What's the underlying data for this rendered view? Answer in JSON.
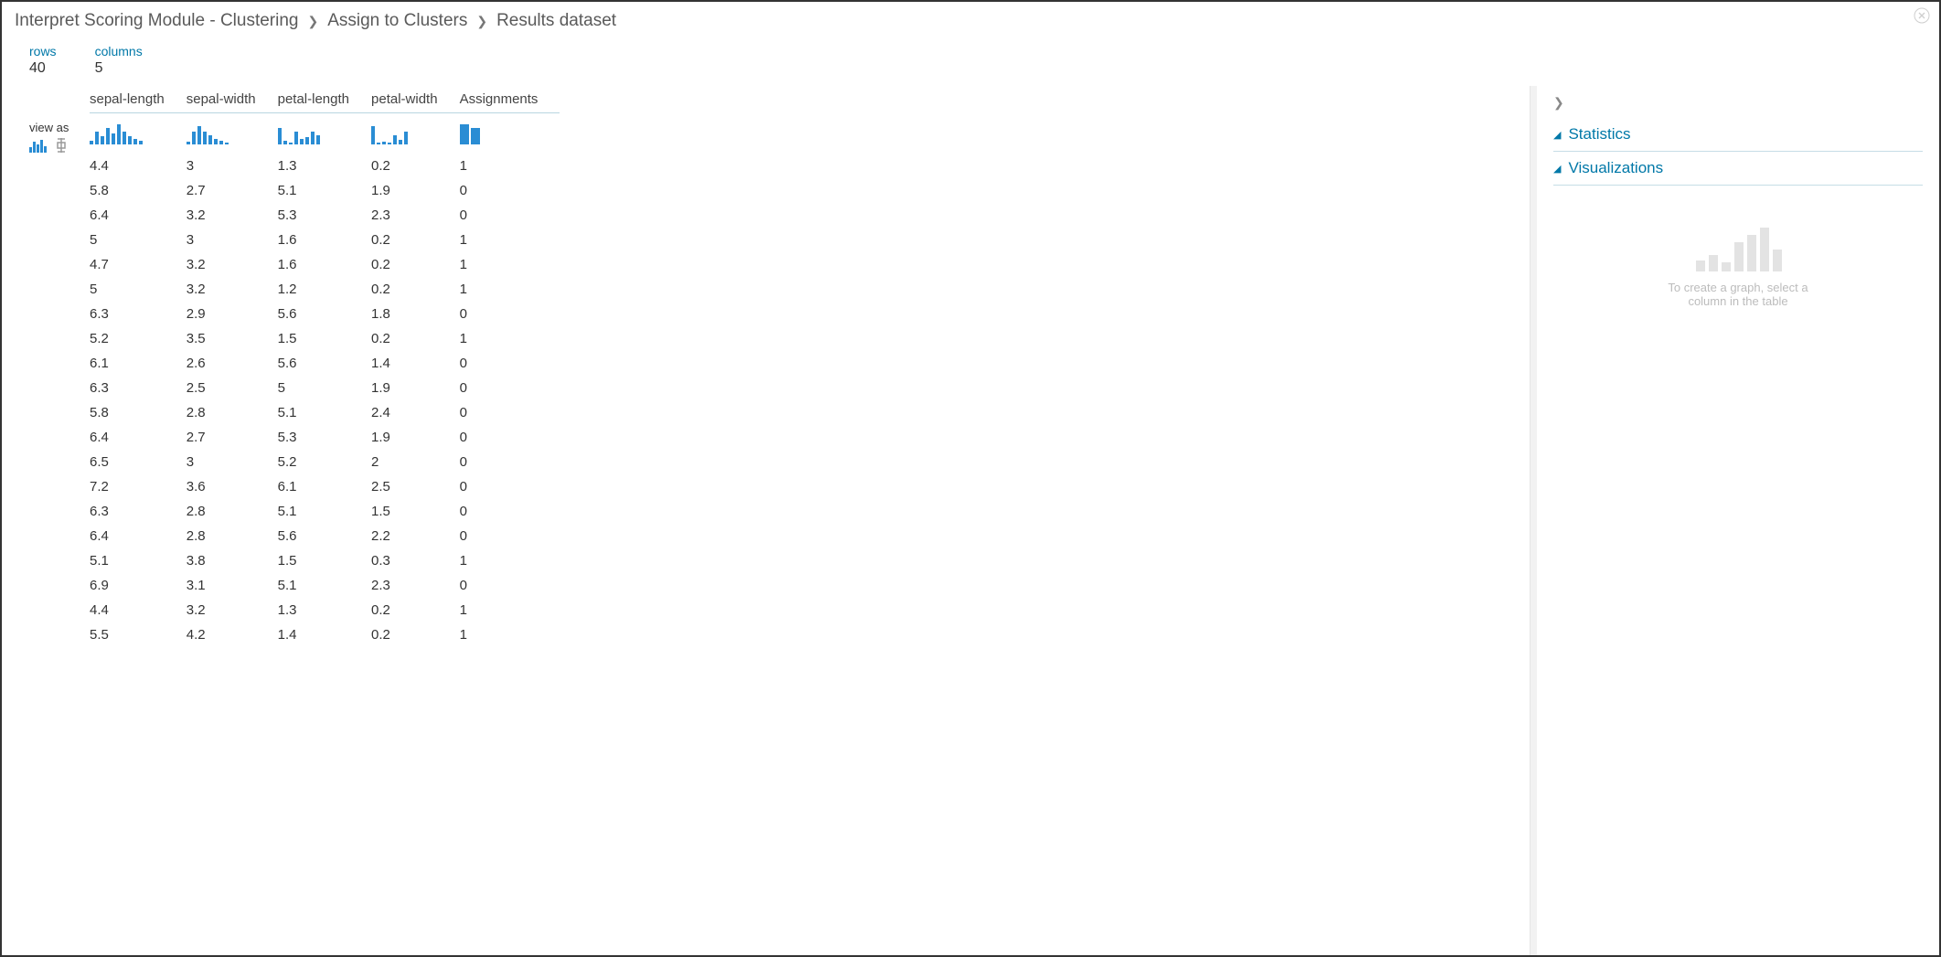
{
  "breadcrumb": [
    "Interpret Scoring Module - Clustering",
    "Assign to Clusters",
    "Results dataset"
  ],
  "meta": {
    "rows_label": "rows",
    "rows_value": "40",
    "cols_label": "columns",
    "cols_value": "5"
  },
  "viewas_label": "view as",
  "columns": [
    "sepal-length",
    "sepal-width",
    "petal-length",
    "petal-width",
    "Assignments"
  ],
  "sparklines": [
    [
      4,
      14,
      9,
      18,
      12,
      22,
      14,
      9,
      6,
      4
    ],
    [
      3,
      14,
      20,
      14,
      10,
      6,
      4,
      2
    ],
    [
      18,
      4,
      2,
      14,
      6,
      8,
      14,
      10
    ],
    [
      20,
      2,
      3,
      2,
      10,
      5,
      14
    ],
    [
      22,
      18
    ]
  ],
  "rows": [
    [
      "4.4",
      "3",
      "1.3",
      "0.2",
      "1"
    ],
    [
      "5.8",
      "2.7",
      "5.1",
      "1.9",
      "0"
    ],
    [
      "6.4",
      "3.2",
      "5.3",
      "2.3",
      "0"
    ],
    [
      "5",
      "3",
      "1.6",
      "0.2",
      "1"
    ],
    [
      "4.7",
      "3.2",
      "1.6",
      "0.2",
      "1"
    ],
    [
      "5",
      "3.2",
      "1.2",
      "0.2",
      "1"
    ],
    [
      "6.3",
      "2.9",
      "5.6",
      "1.8",
      "0"
    ],
    [
      "5.2",
      "3.5",
      "1.5",
      "0.2",
      "1"
    ],
    [
      "6.1",
      "2.6",
      "5.6",
      "1.4",
      "0"
    ],
    [
      "6.3",
      "2.5",
      "5",
      "1.9",
      "0"
    ],
    [
      "5.8",
      "2.8",
      "5.1",
      "2.4",
      "0"
    ],
    [
      "6.4",
      "2.7",
      "5.3",
      "1.9",
      "0"
    ],
    [
      "6.5",
      "3",
      "5.2",
      "2",
      "0"
    ],
    [
      "7.2",
      "3.6",
      "6.1",
      "2.5",
      "0"
    ],
    [
      "6.3",
      "2.8",
      "5.1",
      "1.5",
      "0"
    ],
    [
      "6.4",
      "2.8",
      "5.6",
      "2.2",
      "0"
    ],
    [
      "5.1",
      "3.8",
      "1.5",
      "0.3",
      "1"
    ],
    [
      "6.9",
      "3.1",
      "5.1",
      "2.3",
      "0"
    ],
    [
      "4.4",
      "3.2",
      "1.3",
      "0.2",
      "1"
    ],
    [
      "5.5",
      "4.2",
      "1.4",
      "0.2",
      "1"
    ]
  ],
  "right": {
    "statistics_label": "Statistics",
    "visualizations_label": "Visualizations",
    "placeholder_text": "To create a graph, select a column in the table"
  },
  "chart_data": {
    "type": "table",
    "title": "Results dataset",
    "columns": [
      "sepal-length",
      "sepal-width",
      "petal-length",
      "petal-width",
      "Assignments"
    ],
    "rows_shown": 20,
    "total_rows": 40,
    "data": [
      [
        4.4,
        3,
        1.3,
        0.2,
        1
      ],
      [
        5.8,
        2.7,
        5.1,
        1.9,
        0
      ],
      [
        6.4,
        3.2,
        5.3,
        2.3,
        0
      ],
      [
        5,
        3,
        1.6,
        0.2,
        1
      ],
      [
        4.7,
        3.2,
        1.6,
        0.2,
        1
      ],
      [
        5,
        3.2,
        1.2,
        0.2,
        1
      ],
      [
        6.3,
        2.9,
        5.6,
        1.8,
        0
      ],
      [
        5.2,
        3.5,
        1.5,
        0.2,
        1
      ],
      [
        6.1,
        2.6,
        5.6,
        1.4,
        0
      ],
      [
        6.3,
        2.5,
        5,
        1.9,
        0
      ],
      [
        5.8,
        2.8,
        5.1,
        2.4,
        0
      ],
      [
        6.4,
        2.7,
        5.3,
        1.9,
        0
      ],
      [
        6.5,
        3,
        5.2,
        2,
        0
      ],
      [
        7.2,
        3.6,
        6.1,
        2.5,
        0
      ],
      [
        6.3,
        2.8,
        5.1,
        1.5,
        0
      ],
      [
        6.4,
        2.8,
        5.6,
        2.2,
        0
      ],
      [
        5.1,
        3.8,
        1.5,
        0.3,
        1
      ],
      [
        6.9,
        3.1,
        5.1,
        2.3,
        0
      ],
      [
        4.4,
        3.2,
        1.3,
        0.2,
        1
      ],
      [
        5.5,
        4.2,
        1.4,
        0.2,
        1
      ]
    ]
  }
}
